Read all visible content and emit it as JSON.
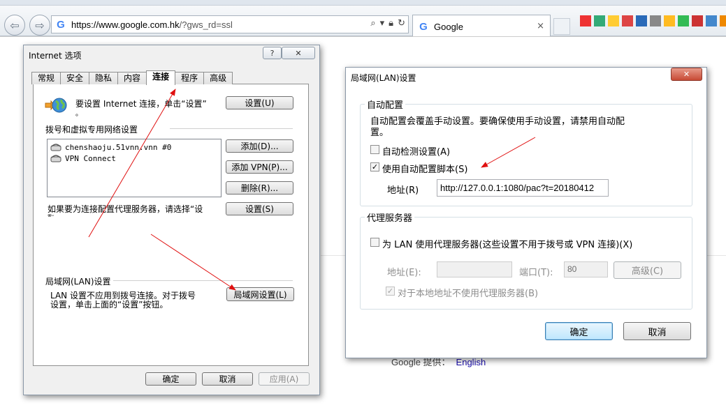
{
  "browser": {
    "address_url_main": "https://www.google.com.hk",
    "address_url_rest": "/?gws_rd=ssl",
    "tab_title": "Google",
    "tab_close": "×",
    "google_footer_label": "Google 提供：",
    "google_footer_link": "English"
  },
  "internet_options": {
    "title": "Internet 选项",
    "help_btn": "?",
    "close_btn": "✕",
    "tabs": [
      "常规",
      "安全",
      "隐私",
      "内容",
      "连接",
      "程序",
      "高级"
    ],
    "active_tab": "连接",
    "setup_text": "要设置 Internet 连接，单击“设置”",
    "setup_text_cont": "。",
    "setup_button": "设置(U)",
    "dialup_heading": "拨号和虚拟专用网络设置",
    "connections": [
      "chenshaoju.51vnn.vnn #0",
      "VPN Connect"
    ],
    "add_button": "添加(D)...",
    "add_vpn_button": "添加 VPN(P)...",
    "remove_button": "删除(R)...",
    "proxy_hint": "如果要为连接配置代理服务器，请选择“设",
    "proxy_hint_cont": "置”。",
    "settings_button": "设置(S)",
    "lan_heading": "局域网(LAN)设置",
    "lan_text_line1": "LAN 设置不应用到拨号连接。对于拨号",
    "lan_text_line2": "设置，单击上面的“设置”按钮。",
    "lan_button": "局域网设置(L)",
    "ok_button": "确定",
    "cancel_button": "取消",
    "apply_button": "应用(A)"
  },
  "lan_dialog": {
    "title": "局域网(LAN)设置",
    "close_btn": "✕",
    "auto_group_title": "自动配置",
    "auto_desc_line1": "自动配置会覆盖手动设置。要确保使用手动设置，请禁用自动配",
    "auto_desc_line2": "置。",
    "auto_detect_label": "自动检测设置(A)",
    "auto_detect_checked": false,
    "use_script_label": "使用自动配置脚本(S)",
    "use_script_checked": true,
    "address_label": "地址(R)",
    "script_address": "http://127.0.0.1:1080/pac?t=20180412",
    "proxy_group_title": "代理服务器",
    "use_proxy_label": "为 LAN 使用代理服务器(这些设置不用于拨号或 VPN 连接)(X)",
    "use_proxy_checked": false,
    "proxy_address_label": "地址(E):",
    "proxy_address_value": "",
    "port_label": "端口(T):",
    "port_value": "80",
    "advanced_button": "高级(C)",
    "bypass_label": "对于本地地址不使用代理服务器(B)",
    "bypass_checked": true,
    "ok_button": "确定",
    "cancel_button": "取消"
  },
  "colors": {
    "annotation_arrow": "#e01010",
    "dialog_border": "#8a98a8",
    "close_button_red": "#c74a35",
    "link_blue": "#1a0dab"
  }
}
